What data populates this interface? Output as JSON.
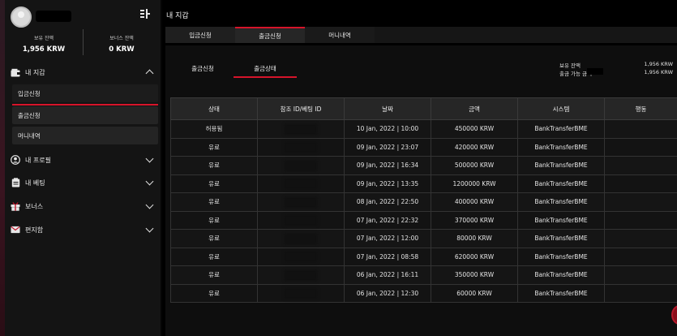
{
  "sidebar": {
    "balance_label": "보유 잔액",
    "balance_value": "1,956 KRW",
    "bonus_label": "보너스 잔액",
    "bonus_value": "0 KRW",
    "sections": [
      {
        "label": "내 지갑",
        "icon": "wallet-icon",
        "expanded": true
      },
      {
        "label": "내 프로필",
        "icon": "user-circle-icon",
        "expanded": false
      },
      {
        "label": "내 베팅",
        "icon": "clipboard-icon",
        "expanded": false
      },
      {
        "label": "보너스",
        "icon": "gift-icon",
        "expanded": false
      },
      {
        "label": "편지함",
        "icon": "envelope-icon",
        "expanded": false
      }
    ],
    "wallet_items": [
      "입금신청",
      "출금신청",
      "머니내역"
    ]
  },
  "main": {
    "title": "내 지갑",
    "tabs": [
      "입금신청",
      "출금신청",
      "머니내역"
    ],
    "sub_tabs": [
      "출금신청",
      "출금상태"
    ],
    "summary": {
      "balance_label": "보유 잔액",
      "balance_value": "1,956 KRW",
      "withdrawable_label": "출금 가능 금액",
      "withdrawable_value": "1,956 KRW"
    }
  },
  "table": {
    "columns": [
      "상태",
      "참조 ID/베팅 ID",
      "날짜",
      "금액",
      "시스템",
      "행동"
    ],
    "rows": [
      {
        "status": "허용됨",
        "date": "10 Jan, 2022 | 10:00",
        "amount": "450000 KRW",
        "system": "BankTransferBME"
      },
      {
        "status": "유료",
        "date": "09 Jan, 2022 | 23:07",
        "amount": "420000 KRW",
        "system": "BankTransferBME"
      },
      {
        "status": "유료",
        "date": "09 Jan, 2022 | 16:34",
        "amount": "500000 KRW",
        "system": "BankTransferBME"
      },
      {
        "status": "유료",
        "date": "09 Jan, 2022 | 13:35",
        "amount": "1200000 KRW",
        "system": "BankTransferBME"
      },
      {
        "status": "유료",
        "date": "08 Jan, 2022 | 22:50",
        "amount": "400000 KRW",
        "system": "BankTransferBME"
      },
      {
        "status": "유료",
        "date": "07 Jan, 2022 | 22:32",
        "amount": "370000 KRW",
        "system": "BankTransferBME"
      },
      {
        "status": "유료",
        "date": "07 Jan, 2022 | 12:00",
        "amount": "80000 KRW",
        "system": "BankTransferBME"
      },
      {
        "status": "유료",
        "date": "07 Jan, 2022 | 08:58",
        "amount": "620000 KRW",
        "system": "BankTransferBME"
      },
      {
        "status": "유료",
        "date": "06 Jan, 2022 | 16:11",
        "amount": "350000 KRW",
        "system": "BankTransferBME"
      },
      {
        "status": "유료",
        "date": "06 Jan, 2022 | 12:30",
        "amount": "60000 KRW",
        "system": "BankTransferBME"
      }
    ]
  }
}
